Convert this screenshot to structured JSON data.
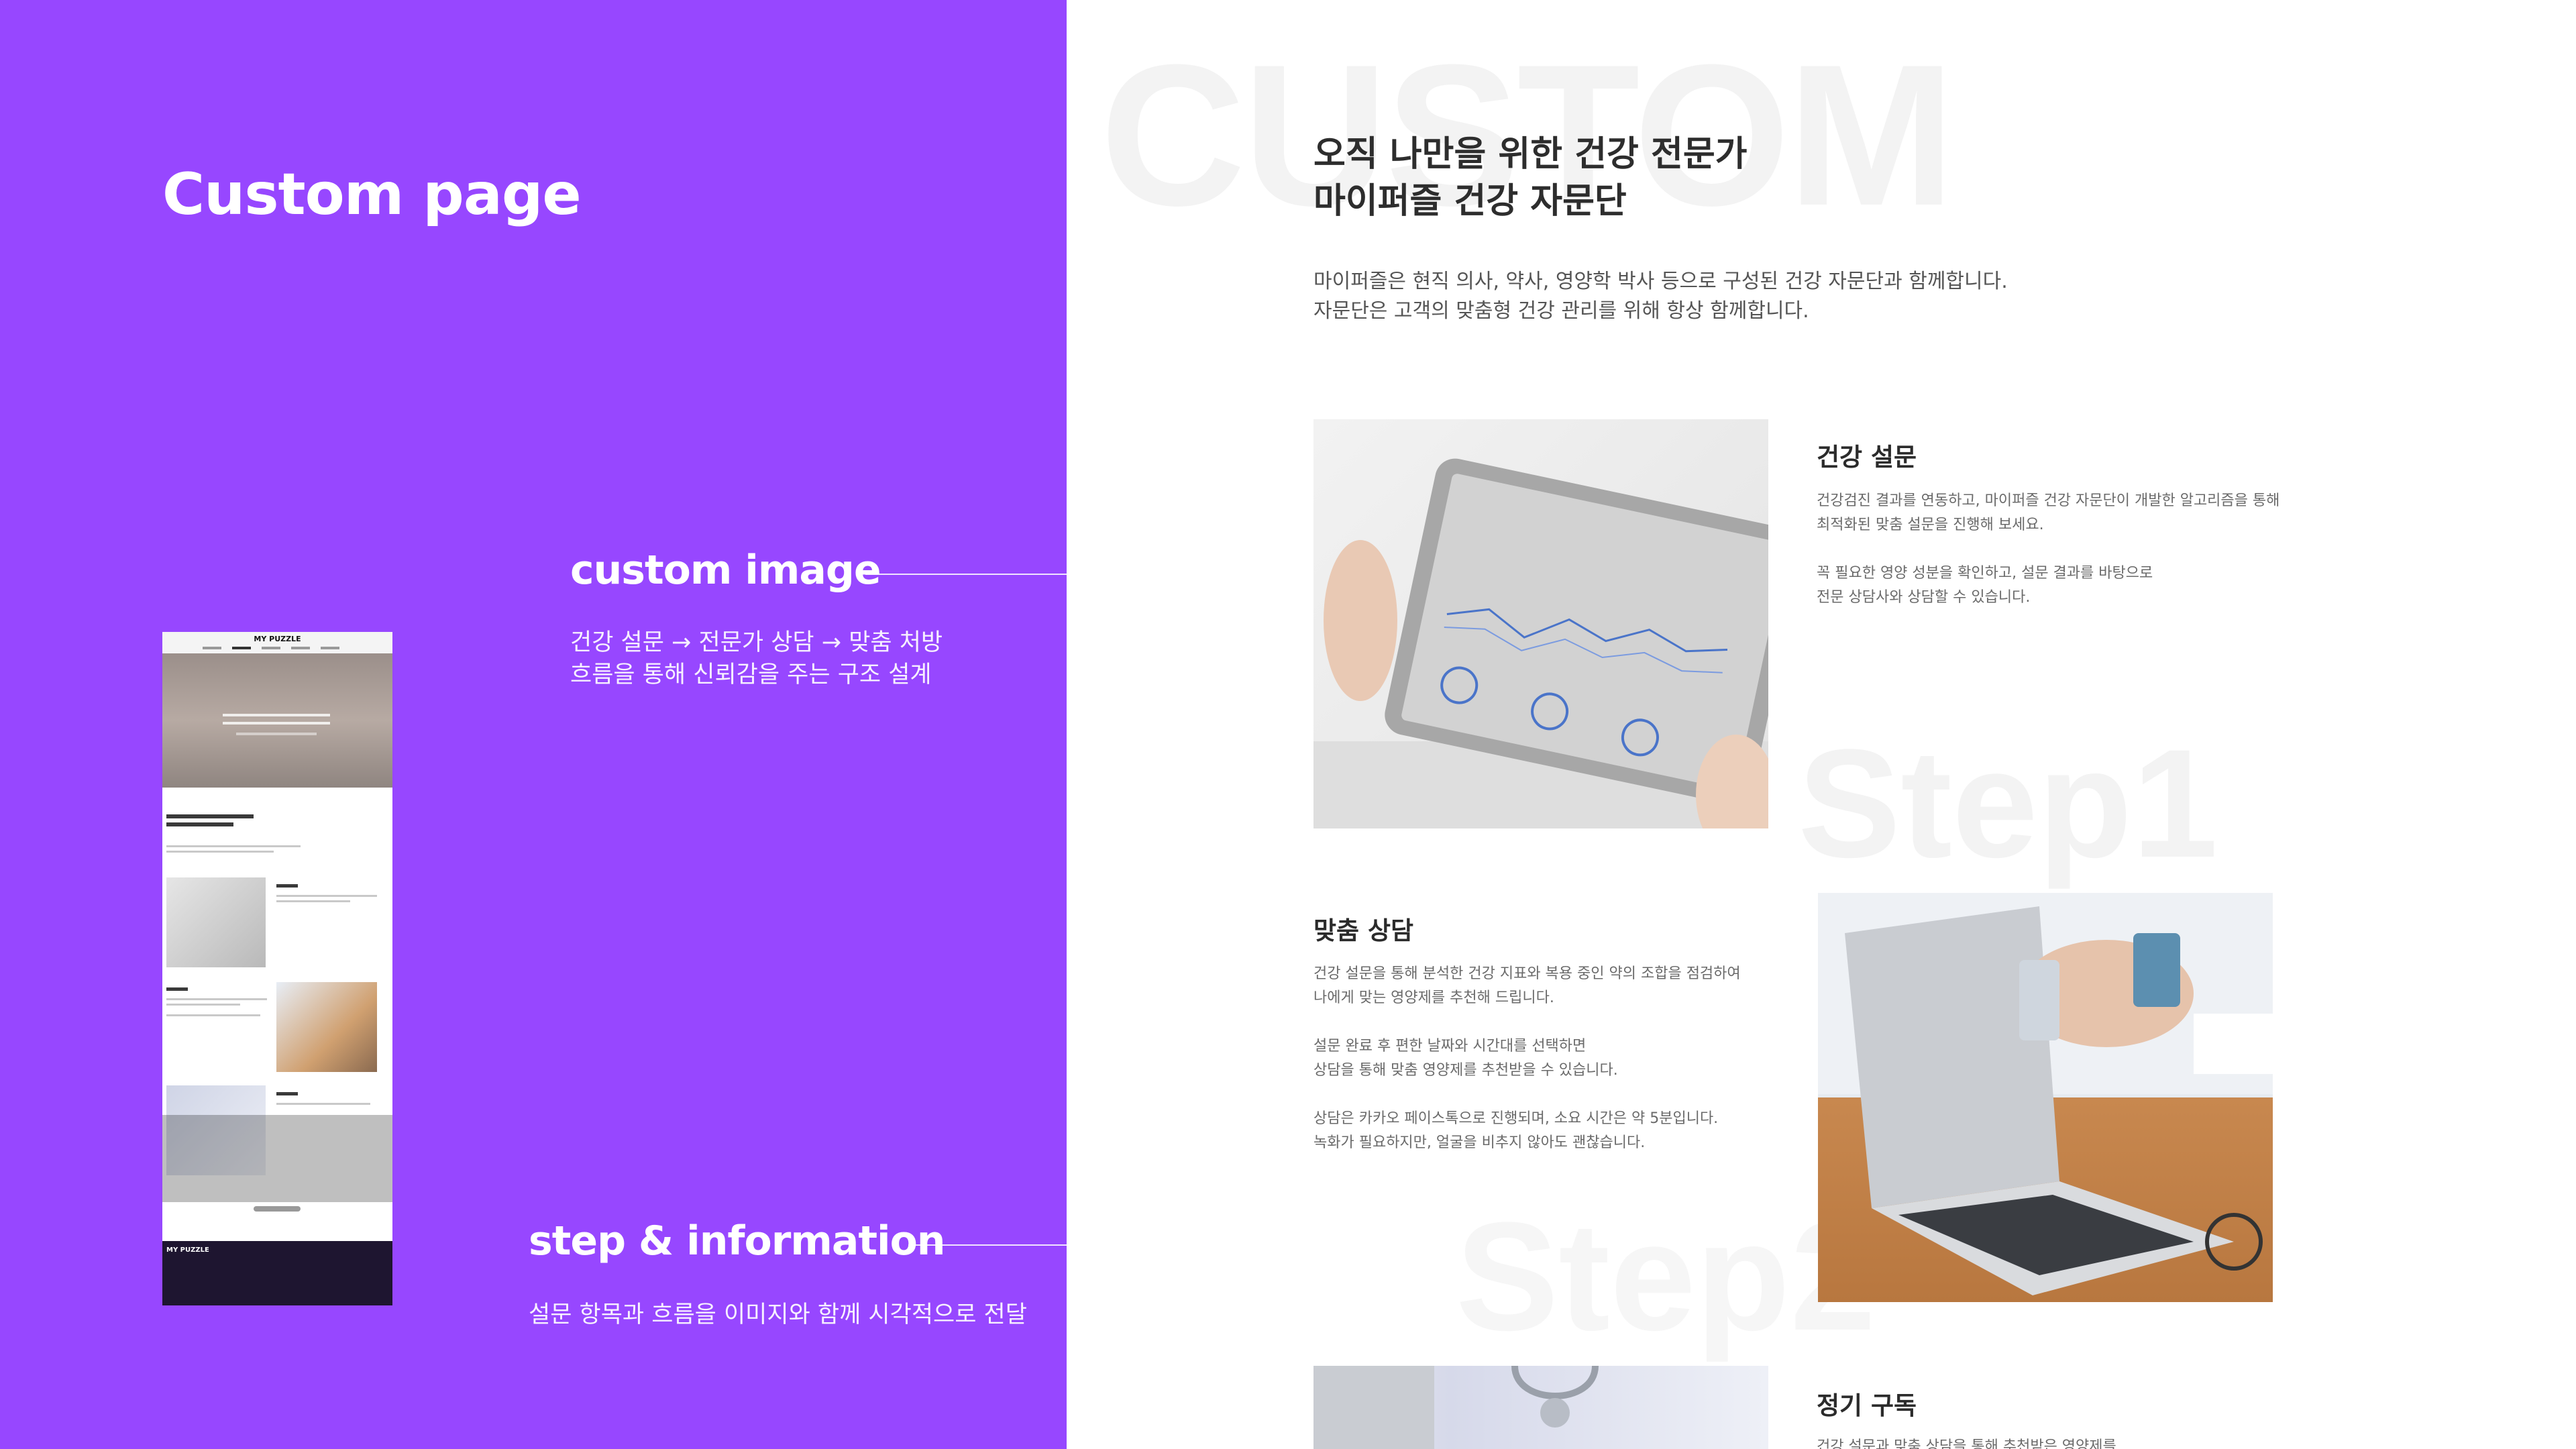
{
  "left": {
    "title": "Custom page",
    "custom_image": {
      "label": "custom image",
      "desc_line1": "건강 설문 → 전문가 상담 → 맞춤 처방",
      "desc_line2": "흐름을 통해 신뢰감을 주는 구조 설계"
    },
    "step_info": {
      "label": "step & information",
      "desc": "설문 항목과 흐름을 이미지와 함께 시각적으로 전달"
    },
    "thumbnail": {
      "logo": "MY PUZZLE",
      "footer_logo": "MY PUZZLE"
    },
    "bg_color": "#9747ff"
  },
  "right": {
    "watermarks": {
      "custom": "CUSTOM",
      "step1": "Step1",
      "step2": "Step2"
    },
    "heading_line1": "오직 나만을 위한 건강 전문가",
    "heading_line2": "마이퍼즐 건강 자문단",
    "intro_line1": "마이퍼즐은 현직 의사, 약사, 영양학 박사 등으로 구성된 건강 자문단과 함께합니다.",
    "intro_line2": "자문단은 고객의 맞춤형 건강 관리를 위해 항상 함께합니다.",
    "steps": [
      {
        "title": "건강 설문",
        "lines": [
          "건강검진 결과를 연동하고, 마이퍼즐 건강 자문단이 개발한 알고리즘을 통해",
          "최적화된 맞춤 설문을 진행해 보세요.",
          "",
          "꼭 필요한 영양 성분을 확인하고, 설문 결과를 바탕으로",
          "전문 상담사와 상담할 수 있습니다."
        ],
        "image_icon": "tablet-report-image"
      },
      {
        "title": "맞춤 상담",
        "lines": [
          "건강 설문을 통해 분석한 건강 지표와 복용 중인 약의 조합을 점검하여",
          "나에게 맞는 영양제를 추천해 드립니다.",
          "",
          "설문 완료 후 편한 날짜와 시간대를 선택하면",
          "상담을 통해 맞춤 영양제를 추천받을 수 있습니다.",
          "",
          "상담은 카카오 페이스톡으로 진행되며, 소요 시간은 약 5분입니다.",
          "녹화가 필요하지만, 얼굴을 비추지 않아도 괜찮습니다."
        ],
        "image_icon": "laptop-pills-image"
      },
      {
        "title": "정기 구독",
        "lines": [
          "건강 설문과 맞춤 상담을 통해 추천받은 영양제를"
        ],
        "image_icon": "stethoscope-image"
      }
    ]
  }
}
